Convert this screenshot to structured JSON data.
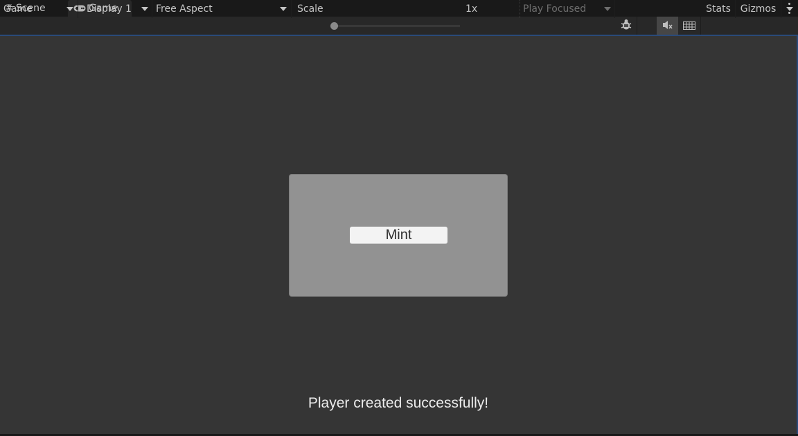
{
  "tabs": [
    {
      "label": "Scene",
      "icon": "hash-icon",
      "active": false
    },
    {
      "label": "Game",
      "icon": "gamepad-icon",
      "active": true
    }
  ],
  "toolbar": {
    "view_select": "Game",
    "display_select": "Display 1",
    "aspect_select": "Free Aspect",
    "scale_label": "Scale",
    "scale_value": "1x",
    "scale_fraction": 0.0,
    "play_mode_select": "Play Focused",
    "stats_label": "Stats",
    "gizmos_label": "Gizmos"
  },
  "game_view": {
    "mint_button_label": "Mint",
    "status_message": "Player created successfully!"
  },
  "colors": {
    "viewport_bg": "#353535",
    "panel_bg": "#929292",
    "button_bg": "#f3f3f3",
    "focus_accent": "#2a4a7a"
  }
}
